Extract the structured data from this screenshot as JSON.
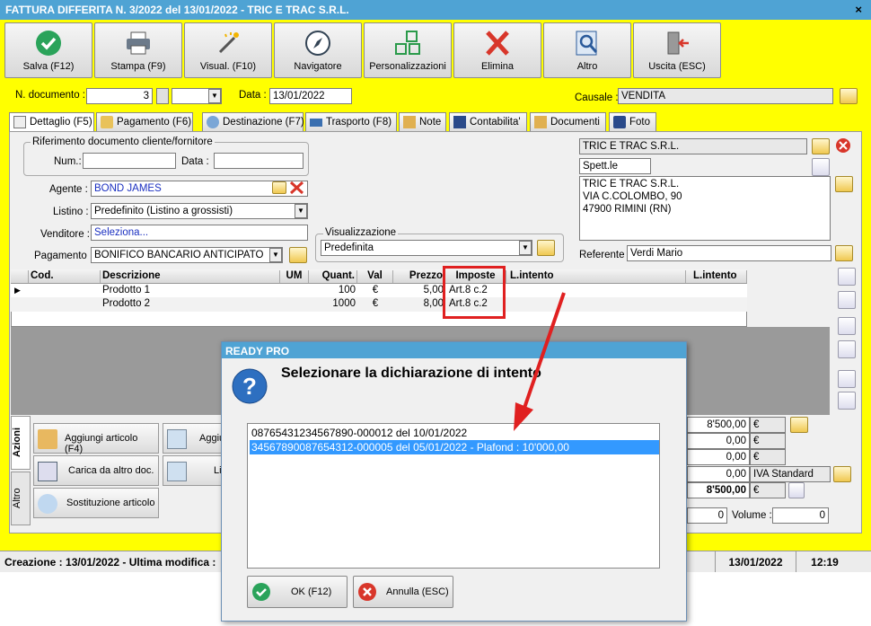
{
  "window": {
    "title": "FATTURA DIFFERITA N. 3/2022 del 13/01/2022 - TRIC E TRAC S.R.L.",
    "close": "×"
  },
  "toolbar": [
    {
      "label": "Salva (F12)",
      "icon": "check-icon"
    },
    {
      "label": "Stampa (F9)",
      "icon": "printer-icon"
    },
    {
      "label": "Visual. (F10)",
      "icon": "magic-wand-icon"
    },
    {
      "label": "Navigatore",
      "icon": "compass-icon"
    },
    {
      "label": "Personalizzazioni",
      "icon": "grid-icon"
    },
    {
      "label": "Elimina",
      "icon": "x-icon"
    },
    {
      "label": "Altro",
      "icon": "magnifier-icon"
    },
    {
      "label": "Uscita (ESC)",
      "icon": "exit-door-icon"
    }
  ],
  "header": {
    "num_label": "N. documento :",
    "num_value": "3",
    "data_label": "Data :",
    "data_value": "13/01/2022",
    "causale_label": "Causale :",
    "causale_value": "VENDITA"
  },
  "tabs": [
    "Dettaglio (F5)",
    "Pagamento (F6)",
    "Destinazione (F7)",
    "Trasporto (F8)",
    "Note",
    "Contabilita'",
    "Documenti",
    "Foto"
  ],
  "rif": {
    "title": "Riferimento documento cliente/fornitore",
    "num_label": "Num.:",
    "data_label": "Data :"
  },
  "form": {
    "agente_label": "Agente :",
    "agente": "BOND JAMES",
    "listino_label": "Listino :",
    "listino": "Predefinito (Listino a grossisti)",
    "venditore_label": "Venditore :",
    "venditore": "Seleziona...",
    "pagamento_label": "Pagamento :",
    "pagamento": "BONIFICO BANCARIO ANTICIPATO",
    "visual_title": "Visualizzazione",
    "visual": "Predefinita"
  },
  "customer": {
    "name": "TRIC E TRAC S.R.L.",
    "spett": "Spett.le",
    "address": [
      "TRIC E TRAC S.R.L.",
      "VIA C.COLOMBO, 90",
      "47900 RIMINI (RN)"
    ],
    "referente_label": "Referente",
    "referente": "Verdi Mario"
  },
  "grid": {
    "headers": [
      "Cod.",
      "Descrizione",
      "UM",
      "Quant.",
      "Val",
      "Prezzo",
      "Imposte",
      "L.intento",
      "L.intento"
    ],
    "rows": [
      {
        "cod": "",
        "desc": "Prodotto 1",
        "um": "",
        "qty": "100",
        "val": "€",
        "price": "5,00",
        "tax": "Art.8 c.2"
      },
      {
        "cod": "",
        "desc": "Prodotto 2",
        "um": "",
        "qty": "1000",
        "val": "€",
        "price": "8,00",
        "tax": "Art.8 c.2"
      }
    ]
  },
  "side_tabs": [
    "Azioni",
    "Altro"
  ],
  "actions": [
    "Aggiungi articolo (F4)",
    "Aggiu",
    "Carica da altro doc.",
    "Li",
    "Sostituzione articolo"
  ],
  "totals": {
    "rows": [
      "8'500,00",
      "0,00",
      "0,00",
      "0,00",
      "8'500,00"
    ],
    "currency": "€",
    "iva": "IVA Standard",
    "colli": "0",
    "volume_label": "Volume :",
    "volume": "0"
  },
  "status": {
    "creation": "Creazione : 13/01/2022 - Ultima modifica :",
    "date": "13/01/2022",
    "time": "12:19"
  },
  "dialog": {
    "title": "READY PRO",
    "message": "Selezionare la dichiarazione di intento",
    "items": [
      "08765431234567890-000012 del 10/01/2022",
      "34567890087654312-000005 del 05/01/2022 - Plafond : 10'000,00"
    ],
    "ok": "OK (F12)",
    "cancel": "Annulla (ESC)"
  },
  "colors": {
    "title": "#4fa3d4",
    "background": "#ffff00",
    "selection": "#3399ff",
    "highlight": "#e02020"
  }
}
